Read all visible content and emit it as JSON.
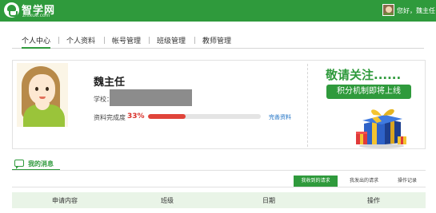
{
  "header": {
    "logo_cn": "智学网",
    "logo_en": "zhixue.com",
    "greeting": "您好，魏主任！"
  },
  "tabs": [
    {
      "label": "个人中心",
      "active": true
    },
    {
      "label": "个人资料",
      "active": false
    },
    {
      "label": "帐号管理",
      "active": false
    },
    {
      "label": "班级管理",
      "active": false
    },
    {
      "label": "教师管理",
      "active": false
    }
  ],
  "profile": {
    "name": "魏主任",
    "school_label": "学校：",
    "progress_label": "资料完成度",
    "progress_text": "33%",
    "progress_value": 33,
    "complete_link": "完善资料"
  },
  "promo": {
    "title": "敬请关注......",
    "subtitle": "积分机制即将上线"
  },
  "messages": {
    "title": "我的消息",
    "subtabs": [
      {
        "label": "我收到的请求",
        "active": true
      },
      {
        "label": "我发出的请求",
        "active": false
      },
      {
        "label": "操作记录",
        "active": false
      }
    ],
    "columns": [
      "申请内容",
      "班级",
      "日期",
      "操作"
    ]
  },
  "colors": {
    "brand": "#2f9a3c",
    "progress": "#e0443a",
    "link": "#1a6fc4"
  }
}
